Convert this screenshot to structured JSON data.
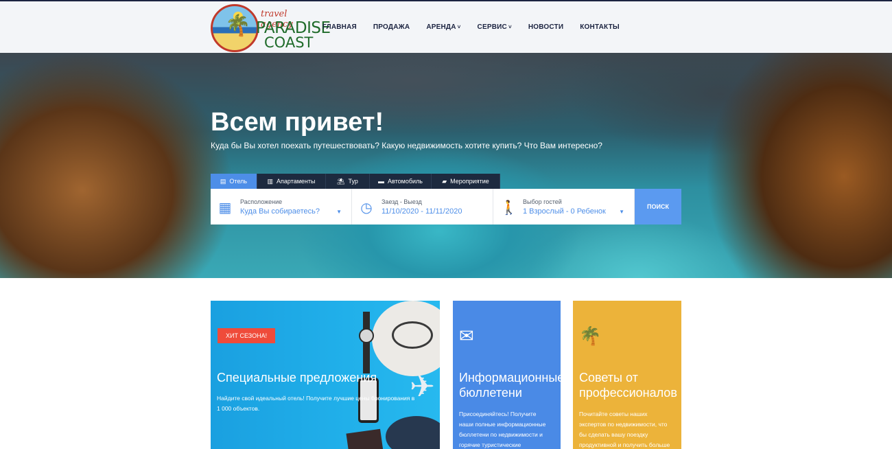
{
  "brand": {
    "tagline": "travel agency",
    "name_line1": "PARADISE",
    "name_line2": "COAST"
  },
  "nav": [
    {
      "label": "ГЛАВНАЯ",
      "has_dropdown": false
    },
    {
      "label": "ПРОДАЖА",
      "has_dropdown": false
    },
    {
      "label": "АРЕНДА",
      "has_dropdown": true
    },
    {
      "label": "СЕРВИС",
      "has_dropdown": true
    },
    {
      "label": "НОВОСТИ",
      "has_dropdown": false
    },
    {
      "label": "КОНТАКТЫ",
      "has_dropdown": false
    }
  ],
  "hero": {
    "title": "Всем привет!",
    "subtitle": "Куда бы Вы хотел поехать путешествовать? Какую недвижимость хотите купить? Что Вам интересно?"
  },
  "tabs": [
    {
      "label": "Отель",
      "icon": "building-icon",
      "active": true
    },
    {
      "label": "Апартаменты",
      "icon": "apartment-icon",
      "active": false
    },
    {
      "label": "Тур",
      "icon": "beach-icon",
      "active": false
    },
    {
      "label": "Автомобиль",
      "icon": "car-icon",
      "active": false
    },
    {
      "label": "Мероприятие",
      "icon": "ticket-icon",
      "active": false
    }
  ],
  "search": {
    "location_label": "Расположение",
    "location_value": "Куда Вы собираетесь?",
    "dates_label": "Заезд - Выезд",
    "dates_value": "11/10/2020 - 11/11/2020",
    "guests_label": "Выбор гостей",
    "guests_value": "1 Взрослый - 0 Ребенок",
    "button": "ПОИСК"
  },
  "cards": {
    "special": {
      "badge": "ХИТ СЕЗОНА!",
      "title": "Специальные предложения",
      "text": "Найдите свой идеальный отель! Получите лучшие цены бронирования в 1 000 объектов."
    },
    "newsletter": {
      "icon": "envelope-icon",
      "title": "Информационные бюллетени",
      "text": "Присоединяйтесь! Получите наши полные информационные бюллетени по недвижимости и горячие туристические"
    },
    "tips": {
      "icon": "palm-tree-icon",
      "title": "Советы от профессионалов",
      "text": "Почитайте советы наших экспертов по недвижимости, что бы сделать вашу поездку продуктивной и получить больше"
    }
  },
  "colors": {
    "accent": "#4d8ee8",
    "dark": "#1b2340",
    "badge": "#ef4b3a",
    "card_blue": "#4a8ae6",
    "card_yellow": "#ecb33a"
  }
}
